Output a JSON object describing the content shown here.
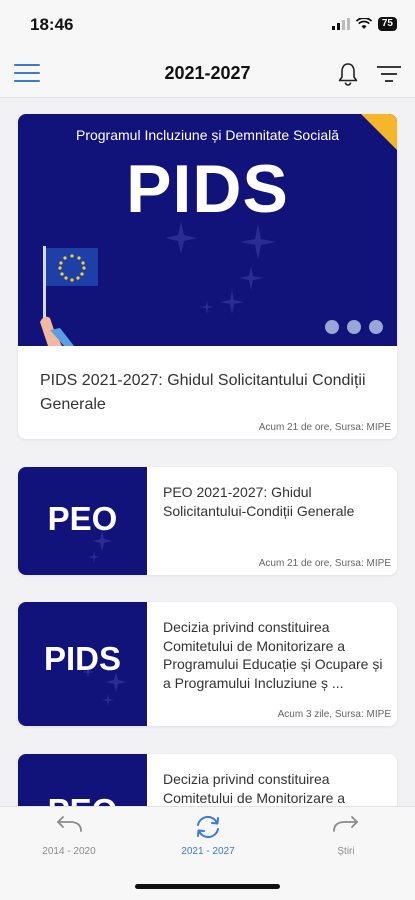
{
  "status_bar": {
    "time": "18:46",
    "battery": "75"
  },
  "header": {
    "title": "2021-2027",
    "icons": [
      "menu-icon",
      "bell-icon",
      "filter-icon"
    ]
  },
  "featured": {
    "banner_subtitle": "Programul Incluziune și Demnitate Socială",
    "banner_title": "PIDS",
    "title": "PIDS 2021-2027: Ghidul Solicitantului Condiții Generale",
    "meta": "Acum 21 de ore, Sursa: MIPE"
  },
  "articles": [
    {
      "thumb": "PEO",
      "title": "PEO 2021-2027: Ghidul Solicitantului-Condiții Generale",
      "meta": "Acum 21 de ore, Sursa: MIPE"
    },
    {
      "thumb": "PIDS",
      "title": "Decizia privind constituirea Comitetului de Monitorizare a Programului Educație și Ocupare și a Programului Incluziune ș ...",
      "meta": "Acum 3 zile, Sursa: MIPE"
    },
    {
      "thumb": "PEO",
      "title": "Decizia privind constituirea Comitetului de Monitorizare a",
      "meta": ""
    }
  ],
  "tabs": [
    {
      "label": "2014 - 2020",
      "icon": "back-arrow-icon"
    },
    {
      "label": "2021 - 2027",
      "icon": "refresh-icon"
    },
    {
      "label": "Știri",
      "icon": "forward-arrow-icon"
    }
  ],
  "colors": {
    "accent": "#3a7bd5",
    "banner": "#12137a",
    "corner": "#f5b72a"
  }
}
